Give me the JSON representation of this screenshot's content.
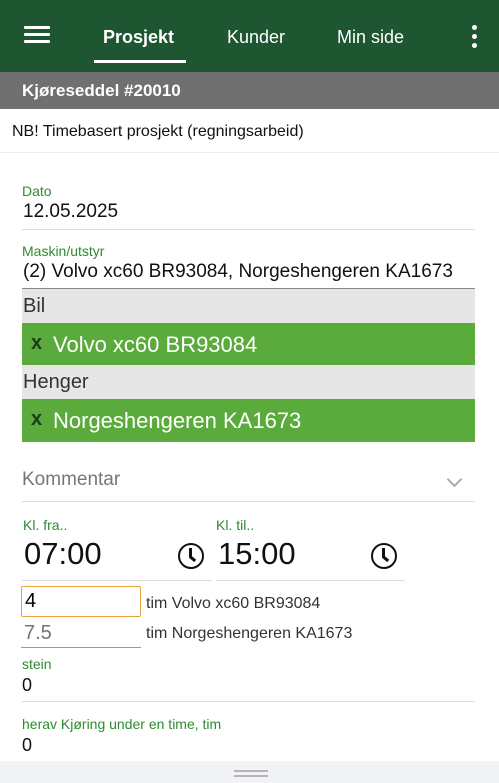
{
  "nav": {
    "tabs": [
      {
        "label": "Prosjekt",
        "active": true
      },
      {
        "label": "Kunder",
        "active": false
      },
      {
        "label": "Min side",
        "active": false
      }
    ],
    "menu_icon": "hamburger-menu-icon",
    "more_icon": "more-vertical-icon"
  },
  "subheader": {
    "title": "Kjøreseddel #20010"
  },
  "notice": {
    "text": "NB! Timebasert prosjekt (regningsarbeid)"
  },
  "form": {
    "date": {
      "label": "Dato",
      "value": "12.05.2025"
    },
    "equipment": {
      "label": "Maskin/utstyr",
      "value": "(2) Volvo xc60 BR93084, Norgeshengeren KA1673",
      "groups": [
        {
          "name": "Bil",
          "items": [
            "Volvo xc60 BR93084"
          ]
        },
        {
          "name": "Henger",
          "items": [
            "Norgeshengeren KA1673"
          ]
        }
      ],
      "remove_symbol": "x"
    },
    "comment": {
      "placeholder": "Kommentar"
    },
    "time_from": {
      "label": "Kl. fra..",
      "value": "07:00"
    },
    "time_to": {
      "label": "Kl. til..",
      "value": "15:00"
    },
    "hours": [
      {
        "value": "4",
        "suffix": "tim Volvo xc60 BR93084"
      },
      {
        "placeholder": "7.5",
        "suffix": "tim Norgeshengeren KA1673"
      }
    ],
    "stein": {
      "label": "stein",
      "value": "0"
    },
    "driving": {
      "label": "herav Kjøring under en time, tim",
      "value": "0"
    }
  },
  "colors": {
    "header_green": "#1e5631",
    "subheader_grey": "#707070",
    "label_green": "#2e8b2e",
    "chip_green": "#5aab3c",
    "active_input_border": "#e8a33a"
  }
}
